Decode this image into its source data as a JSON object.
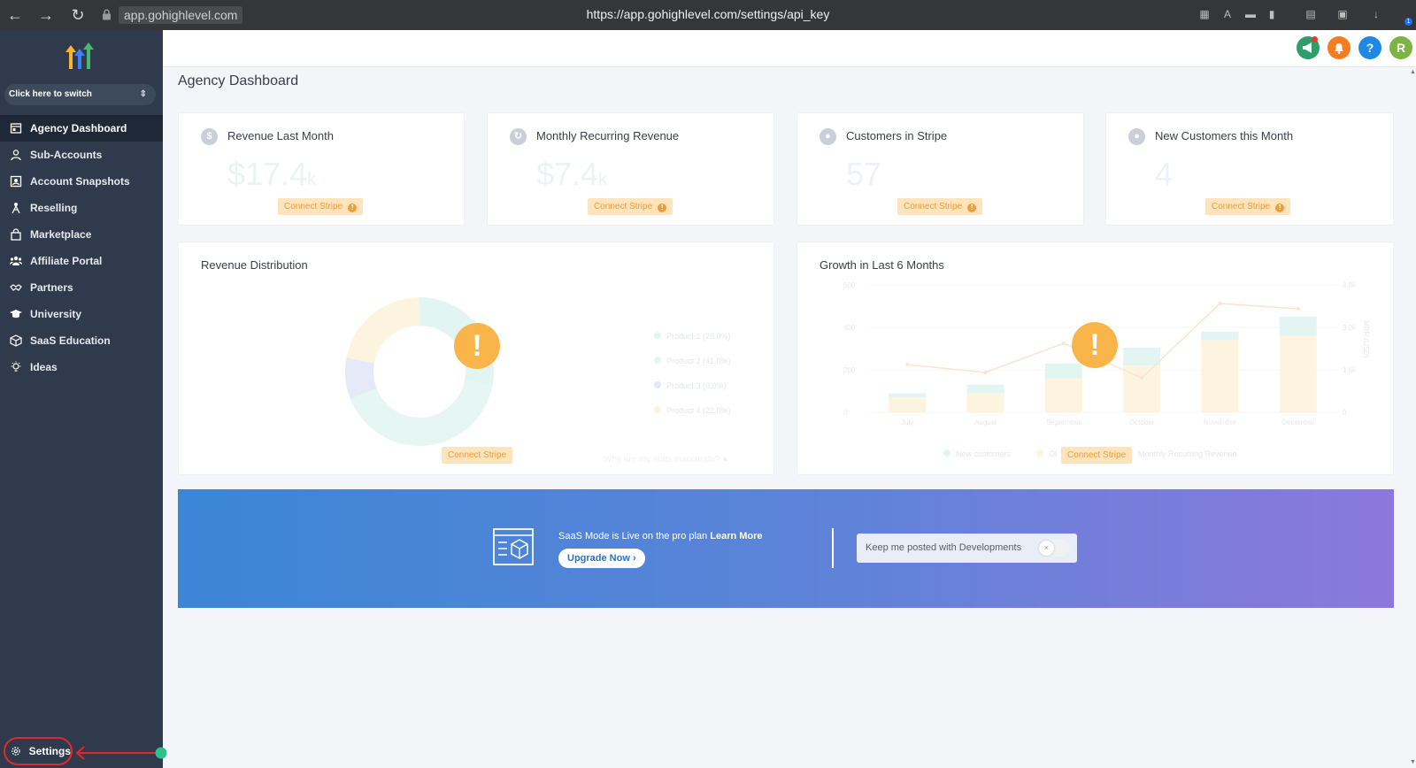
{
  "browser": {
    "host": "app.gohighlevel.com",
    "url": "https://app.gohighlevel.com/settings/api_key",
    "download_badge": "1"
  },
  "sidebar": {
    "switcher_label": "Click here to switch",
    "items": [
      {
        "label": "Agency Dashboard",
        "icon": "dashboard-icon",
        "active": true
      },
      {
        "label": "Sub-Accounts",
        "icon": "user-icon"
      },
      {
        "label": "Account Snapshots",
        "icon": "snapshot-icon"
      },
      {
        "label": "Reselling",
        "icon": "reselling-icon"
      },
      {
        "label": "Marketplace",
        "icon": "bag-icon"
      },
      {
        "label": "Affiliate Portal",
        "icon": "users-icon"
      },
      {
        "label": "Partners",
        "icon": "handshake-icon"
      },
      {
        "label": "University",
        "icon": "graduation-cap-icon"
      },
      {
        "label": "SaaS Education",
        "icon": "box-icon"
      },
      {
        "label": "Ideas",
        "icon": "lightbulb-icon"
      }
    ],
    "settings_label": "Settings"
  },
  "topbar": {
    "avatar_initial": "R",
    "help_label": "?",
    "colors": {
      "announce": "#2e9e6b",
      "notify": "#f57c1f",
      "help": "#1e88e5",
      "avatar": "#7cb342"
    }
  },
  "page": {
    "title": "Agency Dashboard"
  },
  "stats": [
    {
      "title": "Revenue Last Month",
      "icon_glyph": "$",
      "value": "$17.4",
      "unit": "k",
      "button": "Connect Stripe"
    },
    {
      "title": "Monthly Recurring Revenue",
      "icon_glyph": "↻",
      "value": "$7.4",
      "unit": "k",
      "button": "Connect Stripe"
    },
    {
      "title": "Customers in Stripe",
      "icon_glyph": "●",
      "value": "57",
      "unit": "",
      "button": "Connect Stripe"
    },
    {
      "title": "New Customers this Month",
      "icon_glyph": "●",
      "value": "4",
      "unit": "",
      "button": "Connect Stripe"
    }
  ],
  "revenue_distribution": {
    "title": "Revenue Distribution",
    "button": "Connect Stripe",
    "stats_link": "Why are my stats inaccurate?",
    "legend": [
      {
        "label": "Product 1 (28.0%)",
        "value": 28.0,
        "color": "#e3f5f3"
      },
      {
        "label": "Product 2 (41.0%)",
        "value": 41.0,
        "color": "#e6f6f3"
      },
      {
        "label": "Product 3 (9.0%)",
        "value": 9.0,
        "color": "#e6e9f8"
      },
      {
        "label": "Product 4 (22.0%)",
        "value": 22.0,
        "color": "#fdf4e0"
      }
    ]
  },
  "growth": {
    "title": "Growth in Last 6 Months",
    "button": "Connect Stripe",
    "y_left_ticks": [
      "0",
      "200",
      "400",
      "600"
    ],
    "y_right_ticks": [
      "0",
      "1.6k",
      "3.2k",
      "4.8k"
    ],
    "y_right_label": "MRR (USD)",
    "legend": [
      {
        "label": "New customers",
        "color": "#e3f5f3"
      },
      {
        "label": "Ol",
        "color": "#fdf4e0"
      },
      {
        "label": "Monthly Recurring Revenue",
        "color": "#fbe7d6"
      }
    ]
  },
  "chart_data": [
    {
      "type": "pie",
      "title": "Revenue Distribution",
      "categories": [
        "Product 1",
        "Product 2",
        "Product 3",
        "Product 4"
      ],
      "values": [
        28.0,
        41.0,
        9.0,
        22.0
      ]
    },
    {
      "type": "bar",
      "title": "Growth in Last 6 Months",
      "categories": [
        "July",
        "August",
        "September",
        "October",
        "November",
        "December"
      ],
      "series": [
        {
          "name": "New customers",
          "values": [
            20,
            40,
            70,
            85,
            40,
            90
          ]
        },
        {
          "name": "Ol",
          "values": [
            70,
            90,
            160,
            220,
            340,
            360
          ]
        },
        {
          "name": "Monthly Recurring Revenue",
          "values": [
            1800,
            1500,
            2600,
            1300,
            4100,
            3900
          ]
        }
      ],
      "ylim": [
        0,
        600
      ],
      "y2lim": [
        0,
        4800
      ],
      "ylabel2": "MRR (USD)",
      "colors": {
        "new": "#e3f5f3",
        "old": "#fdf4e0",
        "mrr": "#fbe3cf"
      }
    }
  ],
  "banner": {
    "text_prefix": "SaaS Mode is Live on the pro plan ",
    "text_link": "Learn More",
    "upgrade_label": "Upgrade Now",
    "keep_label": "Keep me posted with Developments",
    "toggle_glyph": "×"
  }
}
